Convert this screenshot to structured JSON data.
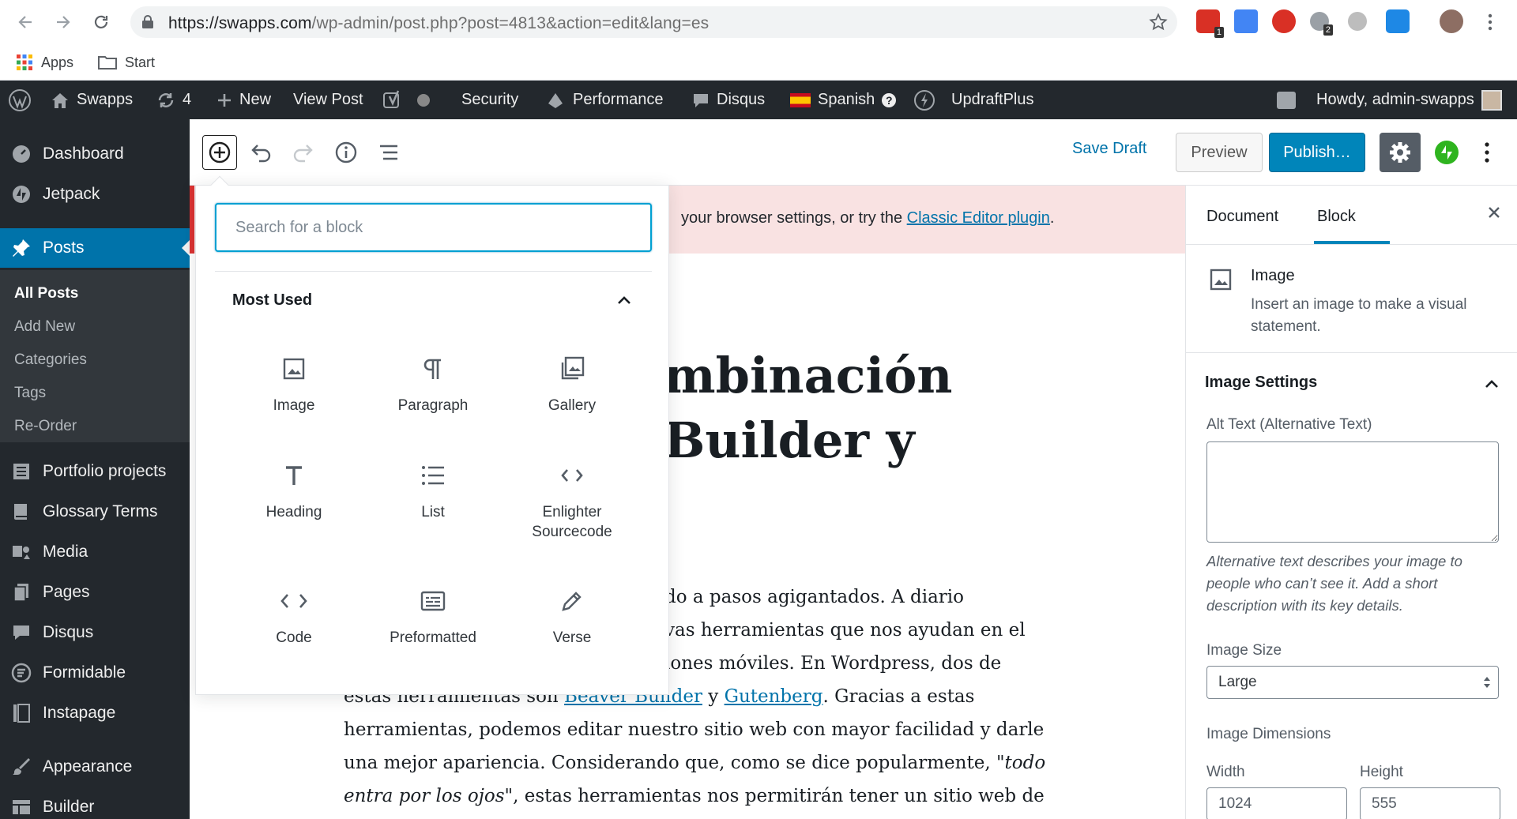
{
  "browser": {
    "url_host": "https://swapps.com",
    "url_path": "/wp-admin/post.php?post=4813&action=edit&lang=es",
    "extension_badges": [
      "1",
      "2"
    ],
    "bookmarks": [
      "Apps",
      "Start"
    ]
  },
  "admin_bar": {
    "site_name": "Swapps",
    "updates_count": "4",
    "new_label": "New",
    "view_post": "View Post",
    "security": "Security",
    "performance": "Performance",
    "disqus": "Disqus",
    "language": "Spanish",
    "updraft": "UpdraftPlus",
    "howdy": "Howdy, admin-swapps"
  },
  "sidebar": {
    "items": [
      {
        "label": "Dashboard",
        "icon": "dashboard-icon"
      },
      {
        "label": "Jetpack",
        "icon": "jetpack-icon"
      },
      {
        "label": "Posts",
        "icon": "pushpin-icon"
      },
      {
        "label": "Portfolio projects",
        "icon": "portfolio-icon"
      },
      {
        "label": "Glossary Terms",
        "icon": "book-icon"
      },
      {
        "label": "Media",
        "icon": "media-icon"
      },
      {
        "label": "Pages",
        "icon": "pages-icon"
      },
      {
        "label": "Disqus",
        "icon": "comment-icon"
      },
      {
        "label": "Formidable",
        "icon": "formidable-icon"
      },
      {
        "label": "Instapage",
        "icon": "instapage-icon"
      },
      {
        "label": "Appearance",
        "icon": "brush-icon"
      },
      {
        "label": "Builder",
        "icon": "builder-icon"
      }
    ],
    "submenu": [
      "All Posts",
      "Add New",
      "Categories",
      "Tags",
      "Re-Order"
    ]
  },
  "toolbar": {
    "save_draft": "Save Draft",
    "preview": "Preview",
    "publish": "Publish…"
  },
  "notice": {
    "text": "your browser settings, or try the ",
    "link": "Classic Editor plugin",
    "end": "."
  },
  "post": {
    "title_lines": [
      "mbinación",
      "Builder y"
    ],
    "body": {
      "l1": "do a pasos agigantados. A diario",
      "l2": "vas herramientas que nos ayudan en el",
      "l3": "iones móviles. En Wordpress, dos de",
      "l4a": "estas herramientas son ",
      "l4link1": "Beaver Builder",
      "l4b": " y ",
      "l4link2": "Gutenberg",
      "l4c": ". Gracias a estas",
      "l5": "herramientas, podemos editar nuestro sitio web con mayor facilidad y darle",
      "l6a": "una mejor apariencia. Considerando que, como se dice popularmente, ",
      "l6em": "\"todo",
      "l7em": "entra por los ojos\"",
      "l7b": ", estas herramientas nos permitirán tener un sitio web de"
    }
  },
  "inserter": {
    "search_placeholder": "Search for a block",
    "section_title": "Most Used",
    "blocks": [
      {
        "label": "Image",
        "icon": "image-icon"
      },
      {
        "label": "Paragraph",
        "icon": "paragraph-icon"
      },
      {
        "label": "Gallery",
        "icon": "gallery-icon"
      },
      {
        "label": "Heading",
        "icon": "heading-icon"
      },
      {
        "label": "List",
        "icon": "list-icon"
      },
      {
        "label": "Enlighter Sourcecode",
        "icon": "code-icon"
      },
      {
        "label": "Code",
        "icon": "code-icon"
      },
      {
        "label": "Preformatted",
        "icon": "preformatted-icon"
      },
      {
        "label": "Verse",
        "icon": "pencil-icon"
      }
    ]
  },
  "panel": {
    "tab_document": "Document",
    "tab_block": "Block",
    "block_title": "Image",
    "block_desc": "Insert an image to make a visual statement.",
    "image_settings": "Image Settings",
    "alt_label": "Alt Text (Alternative Text)",
    "alt_help": "Alternative text describes your image to people who can’t see it. Add a short description with its key details.",
    "size_label": "Image Size",
    "size_value": "Large",
    "dims_label": "Image Dimensions",
    "width_label": "Width",
    "height_label": "Height",
    "width_value": "1024",
    "height_value": "555"
  },
  "colors": {
    "wp_dark": "#23282d",
    "wp_blue": "#0073aa",
    "publish_blue": "#0085ba",
    "notice_bg": "#f9e2e2",
    "jetpack_green": "#2fb41f"
  }
}
